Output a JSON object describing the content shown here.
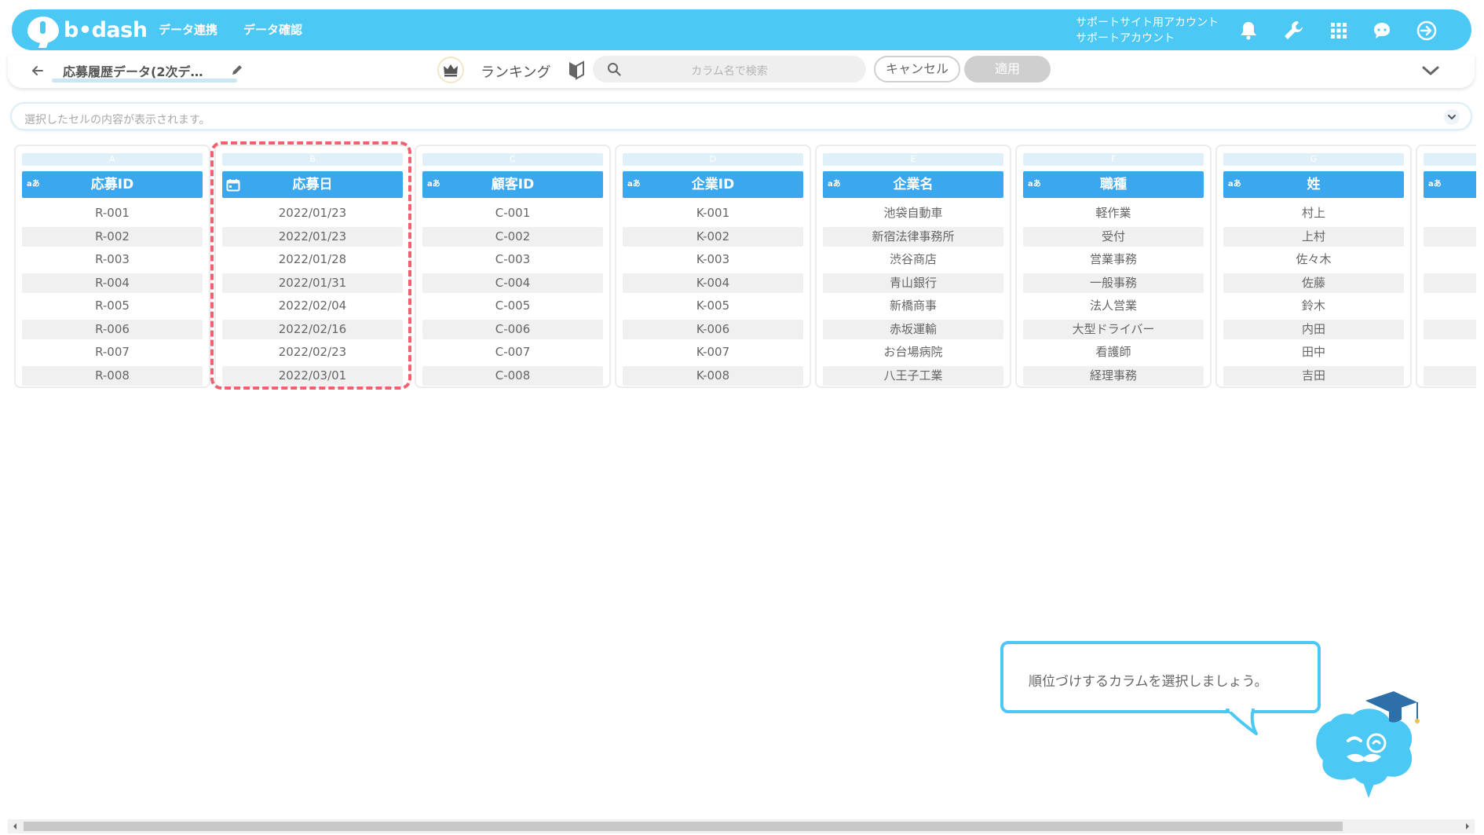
{
  "nav": {
    "brand": "b•dash",
    "links": [
      "データ連携",
      "データ確認"
    ],
    "account_line1": "サポートサイト用アカウント",
    "account_line2": "サポートアカウント",
    "icons": [
      "bell-icon",
      "wrench-icon",
      "grid-icon",
      "chat-icon",
      "logout-icon"
    ],
    "color": "#4cc8f5"
  },
  "subheader": {
    "dataset_title": "応募履歴データ(2次デ…",
    "mode_label": "ランキング",
    "search_placeholder": "カラム名で検索",
    "cancel_label": "キャンセル",
    "apply_label": "適用"
  },
  "cellviewer": {
    "placeholder": "選択したセルの内容が表示されます。"
  },
  "table": {
    "header_color": "#3ba7ee",
    "columns": [
      {
        "letter": "A",
        "type": "aあ",
        "name": "応募ID",
        "rows": [
          "R-001",
          "R-002",
          "R-003",
          "R-004",
          "R-005",
          "R-006",
          "R-007",
          "R-008"
        ]
      },
      {
        "letter": "B",
        "type": "date",
        "name": "応募日",
        "rows": [
          "2022/01/23",
          "2022/01/23",
          "2022/01/28",
          "2022/01/31",
          "2022/02/04",
          "2022/02/16",
          "2022/02/23",
          "2022/03/01"
        ]
      },
      {
        "letter": "C",
        "type": "aあ",
        "name": "顧客ID",
        "rows": [
          "C-001",
          "C-002",
          "C-003",
          "C-004",
          "C-005",
          "C-006",
          "C-007",
          "C-008"
        ]
      },
      {
        "letter": "D",
        "type": "aあ",
        "name": "企業ID",
        "rows": [
          "K-001",
          "K-002",
          "K-003",
          "K-004",
          "K-005",
          "K-006",
          "K-007",
          "K-008"
        ]
      },
      {
        "letter": "E",
        "type": "aあ",
        "name": "企業名",
        "rows": [
          "池袋自動車",
          "新宿法律事務所",
          "渋谷商店",
          "青山銀行",
          "新橋商事",
          "赤坂運輸",
          "お台場病院",
          "八王子工業"
        ]
      },
      {
        "letter": "F",
        "type": "aあ",
        "name": "職種",
        "rows": [
          "軽作業",
          "受付",
          "営業事務",
          "一般事務",
          "法人営業",
          "大型ドライバー",
          "看護師",
          "経理事務"
        ]
      },
      {
        "letter": "G",
        "type": "aあ",
        "name": "姓",
        "rows": [
          "村上",
          "上村",
          "佐々木",
          "佐藤",
          "鈴木",
          "内田",
          "田中",
          "吉田"
        ]
      },
      {
        "letter": "",
        "type": "aあ",
        "name": "",
        "rows": [
          "",
          "",
          "",
          "",
          "",
          "",
          "",
          ""
        ]
      }
    ],
    "highlighted_column": "B"
  },
  "tooltip": {
    "text": "順位づけするカラムを選択しましょう。"
  }
}
